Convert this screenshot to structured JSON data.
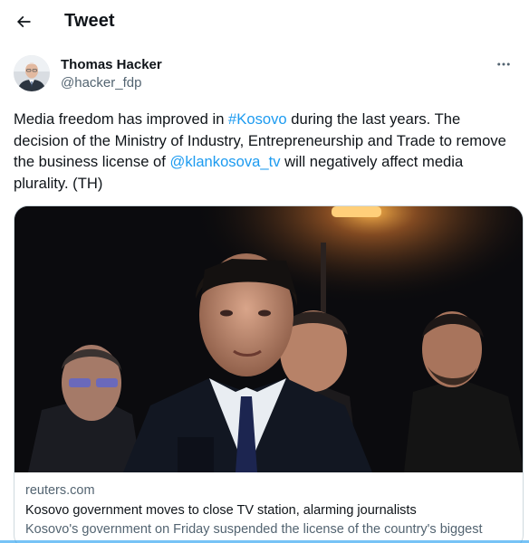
{
  "header": {
    "title": "Tweet",
    "back_icon": "arrow-left-icon"
  },
  "author": {
    "display_name": "Thomas Hacker",
    "handle": "@hacker_fdp",
    "more_icon": "more-horizontal-icon"
  },
  "tweet": {
    "segments": [
      {
        "text": "Media freedom has improved in ",
        "link": false
      },
      {
        "text": "#Kosovo",
        "link": true
      },
      {
        "text": " during the last years. The decision of the Ministry of Industry, Entrepreneurship and Trade to remove the business license of ",
        "link": false
      },
      {
        "text": "@klankosova_tv",
        "link": true
      },
      {
        "text": " will negatively affect media plurality. (TH)",
        "link": false
      }
    ]
  },
  "card": {
    "domain": "reuters.com",
    "title": "Kosovo government moves to close TV station, alarming journalists",
    "description": "Kosovo's government on Friday suspended the license of the country's biggest"
  },
  "colors": {
    "link": "#1d9bf0",
    "text": "#0f1419",
    "secondary": "#536471",
    "border": "#cfd9de"
  }
}
